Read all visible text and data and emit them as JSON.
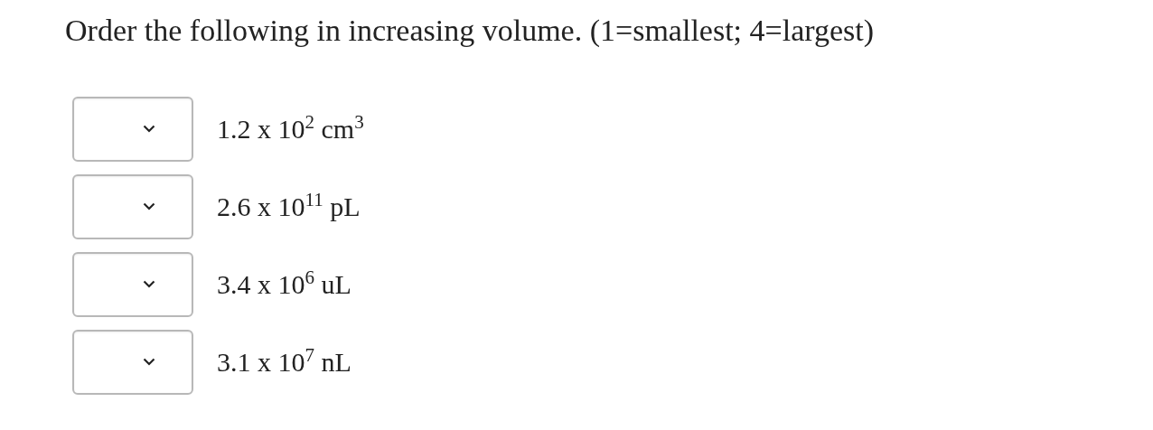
{
  "question": "Order the following in increasing volume. (1=smallest; 4=largest)",
  "items": [
    {
      "label": "1.2 x 10$^{2}$ cm$^{3}$"
    },
    {
      "label": "2.6 x 10$^{11}$ pL"
    },
    {
      "label": "3.4 x 10$^{6}$ uL"
    },
    {
      "label": "3.1 x 10$^{7}$ nL"
    }
  ]
}
